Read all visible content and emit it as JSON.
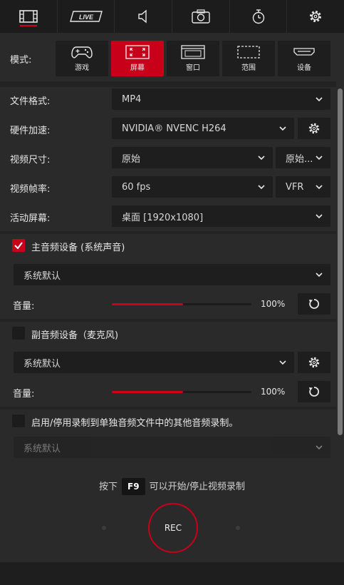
{
  "tabs": [
    {
      "name": "video",
      "icon": "film-icon",
      "active": true
    },
    {
      "name": "live",
      "icon": "live-icon",
      "label": "LIVE"
    },
    {
      "name": "audio",
      "icon": "speaker-icon"
    },
    {
      "name": "screenshot",
      "icon": "camera-icon"
    },
    {
      "name": "timer",
      "icon": "stopwatch-icon"
    },
    {
      "name": "settings",
      "icon": "gear-icon"
    }
  ],
  "mode": {
    "label": "模式:",
    "buttons": [
      {
        "label": "游戏",
        "icon": "gamepad-icon",
        "active": false
      },
      {
        "label": "屏幕",
        "icon": "fullscreen-icon",
        "active": true
      },
      {
        "label": "窗口",
        "icon": "window-icon",
        "active": false
      },
      {
        "label": "范围",
        "icon": "region-icon",
        "active": false
      },
      {
        "label": "设备",
        "icon": "hdmi-icon",
        "active": false
      }
    ]
  },
  "settings": {
    "file_format": {
      "label": "文件格式:",
      "value": "MP4"
    },
    "hw_accel": {
      "label": "硬件加速:",
      "value": "NVIDIA® NVENC H264"
    },
    "video_size": {
      "label": "视频尺寸:",
      "value": "原始",
      "value2": "原始..."
    },
    "frame_rate": {
      "label": "视频帧率:",
      "value": "60 fps",
      "value2": "VFR"
    },
    "active_screen": {
      "label": "活动屏幕:",
      "value": "桌面 [1920x1080]"
    }
  },
  "main_audio": {
    "label": "主音频设备 (系统声音)",
    "checked": true,
    "device": "系统默认",
    "volume_label": "音量:",
    "volume_value": "100%",
    "volume_level": 1.0
  },
  "sub_audio": {
    "label": "副音频设备（麦克风)",
    "checked": false,
    "device": "系统默认",
    "volume_label": "音量:",
    "volume_value": "100%",
    "volume_level": 1.0
  },
  "extra_audio": {
    "label": "启用/停用录制到单独音频文件中的其他音频录制。",
    "checked": false,
    "device": "系统默认"
  },
  "footer": {
    "press": "按下",
    "hotkey": "F9",
    "hint": "可以开始/停止视频录制",
    "rec_label": "REC"
  },
  "colors": {
    "accent": "#c8001a",
    "bg": "#2a2a2a",
    "field": "#1e1e1e"
  }
}
